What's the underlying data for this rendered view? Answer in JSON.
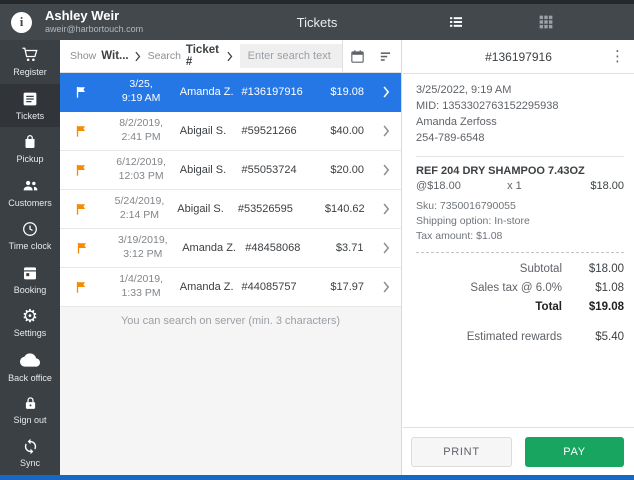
{
  "appbar": {
    "user_name": "Ashley Weir",
    "user_email": "aweir@harbortouch.com",
    "title": "Tickets"
  },
  "sidebar": {
    "items": [
      {
        "icon": "cart-icon",
        "label": "Register"
      },
      {
        "icon": "receipt-icon",
        "label": "Tickets"
      },
      {
        "icon": "bag-icon",
        "label": "Pickup"
      },
      {
        "icon": "people-icon",
        "label": "Customers"
      },
      {
        "icon": "clock-icon",
        "label": "Time clock"
      },
      {
        "icon": "calendar-icon",
        "label": "Booking"
      },
      {
        "icon": "gear-icon",
        "label": "Settings"
      },
      {
        "icon": "cloud-icon",
        "label": "Back office"
      },
      {
        "icon": "lock-icon",
        "label": "Sign out"
      },
      {
        "icon": "sync-icon",
        "label": "Sync"
      }
    ]
  },
  "search": {
    "show_label": "Show",
    "show_value": "Wit...",
    "search_label": "Search",
    "search_value": "Ticket #",
    "placeholder": "Enter search text"
  },
  "tickets": [
    {
      "date": "3/25,",
      "time": "9:19 AM",
      "name": "Amanda Z.",
      "number": "#136197916",
      "amount": "$19.08",
      "selected": true
    },
    {
      "date": "8/2/2019,",
      "time": "2:41 PM",
      "name": "Abigail S.",
      "number": "#59521266",
      "amount": "$40.00",
      "selected": false
    },
    {
      "date": "6/12/2019,",
      "time": "12:03 PM",
      "name": "Abigail S.",
      "number": "#55053724",
      "amount": "$20.00",
      "selected": false
    },
    {
      "date": "5/24/2019,",
      "time": "2:14 PM",
      "name": "Abigail S.",
      "number": "#53526595",
      "amount": "$140.62",
      "selected": false
    },
    {
      "date": "3/19/2019,",
      "time": "3:12 PM",
      "name": "Amanda Z.",
      "number": "#48458068",
      "amount": "$3.71",
      "selected": false
    },
    {
      "date": "1/4/2019,",
      "time": "1:33 PM",
      "name": "Amanda Z.",
      "number": "#44085757",
      "amount": "$17.97",
      "selected": false
    }
  ],
  "hint": "You can search on server (min. 3 characters)",
  "detail": {
    "ticket_number": "#136197916",
    "datetime": "3/25/2022, 9:19 AM",
    "mid": "MID: 1353302763152295938",
    "customer_name": "Amanda Zerfoss",
    "customer_phone": "254-789-6548",
    "item": {
      "name": "REF 204 DRY SHAMPOO 7.43OZ",
      "unit_price": "@$18.00",
      "qty": "x  1",
      "line_total": "$18.00",
      "sku": "Sku: 7350016790055",
      "shipping": "Shipping option: In-store",
      "tax": "Tax amount: $1.08"
    },
    "totals": [
      {
        "label": "Subtotal",
        "value": "$18.00"
      },
      {
        "label": "Sales tax @ 6.0%",
        "value": "$1.08"
      },
      {
        "label": "Total",
        "value": "$19.08"
      }
    ],
    "rewards_label": "Estimated rewards",
    "rewards_value": "$5.40",
    "print_label": "PRINT",
    "pay_label": "PAY"
  },
  "colors": {
    "appbar_bg": "#43484c",
    "sidebar_bg": "#3b4045",
    "selected_row_blue": "#2577e6",
    "flag_orange": "#f68b00",
    "pay_green": "#18a560",
    "bottom_strip_blue": "#1668c4"
  }
}
